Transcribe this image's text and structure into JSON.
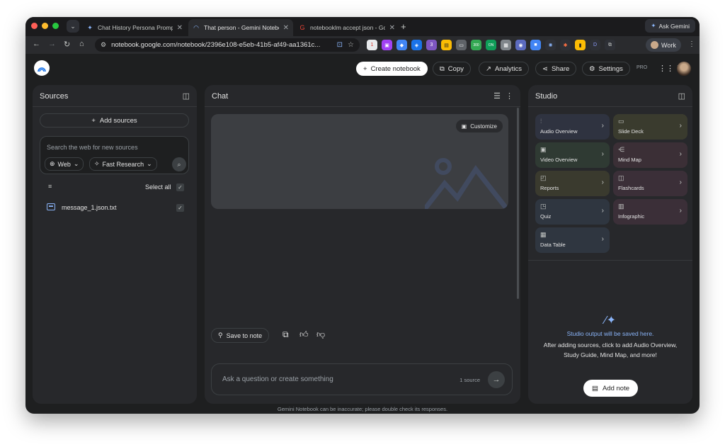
{
  "browser": {
    "tabs": [
      {
        "label": "Chat History Persona Prompt",
        "icon": "gemini-sparkle-icon"
      },
      {
        "label": "That person - Gemini Notebo",
        "icon": "notebooklm-icon"
      },
      {
        "label": "notebooklm accept json - Go",
        "icon": "google-icon"
      }
    ],
    "ask_gemini_label": "Ask Gemini",
    "url": "notebook.google.com/notebook/2396e108-e5eb-41b5-af49-aa1361c...",
    "profile_label": "Work",
    "extension_badges": [
      "1",
      "3",
      "300",
      "ON",
      "D"
    ]
  },
  "header": {
    "create_label": "Create notebook",
    "copy_label": "Copy",
    "analytics_label": "Analytics",
    "share_label": "Share",
    "settings_label": "Settings",
    "pro_label": "PRO"
  },
  "sources": {
    "title": "Sources",
    "add_label": "Add sources",
    "search_placeholder": "Search the web for new sources",
    "web_chip": "Web",
    "research_chip": "Fast Research",
    "select_all_label": "Select all",
    "items": [
      {
        "name": "message_1.json.txt",
        "checked": true
      }
    ]
  },
  "chat": {
    "title": "Chat",
    "customize_label": "Customize",
    "save_note_label": "Save to note",
    "input_placeholder": "Ask a question or create something",
    "source_count": "1 source"
  },
  "studio": {
    "title": "Studio",
    "tiles": [
      {
        "label": "Audio Overview",
        "color": "#2f3340"
      },
      {
        "label": "Slide Deck",
        "color": "#3a3b2e"
      },
      {
        "label": "Video Overview",
        "color": "#2f3a33"
      },
      {
        "label": "Mind Map",
        "color": "#3b2f36"
      },
      {
        "label": "Reports",
        "color": "#3a3a2e"
      },
      {
        "label": "Flashcards",
        "color": "#3b2f38"
      },
      {
        "label": "Quiz",
        "color": "#2f3640"
      },
      {
        "label": "Infographic",
        "color": "#3b2f38"
      },
      {
        "label": "Data Table",
        "color": "#2f3640"
      }
    ],
    "info_title": "Studio output will be saved here.",
    "info_text": "After adding sources, click to add Audio Overview, Study Guide, Mind Map, and more!",
    "add_note_label": "Add note"
  },
  "footer": {
    "disclaimer": "Gemini Notebook can be inaccurate; please double check its responses."
  },
  "colors": {
    "accent_blue": "#8ab4f8",
    "panel_bg": "#27282b",
    "app_bg": "#1e1f20"
  }
}
